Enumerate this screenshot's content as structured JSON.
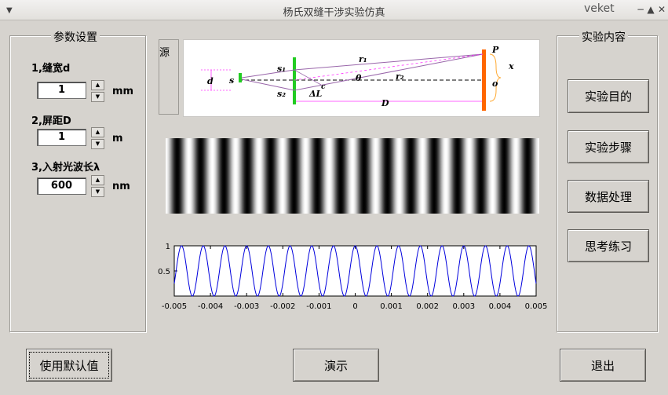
{
  "window": {
    "title": "杨氏双缝干涉实验仿真",
    "app_name": "veket",
    "menu_glyph": "▼",
    "minimize_glyph": "−",
    "maximize_glyph": "▲",
    "close_glyph": "✕"
  },
  "params": {
    "group_title": "参数设置",
    "slit_width_label": "1,缝宽d",
    "slit_width_value": "1",
    "slit_width_unit": "mm",
    "screen_dist_label": "2,屏距D",
    "screen_dist_value": "1",
    "screen_dist_unit": "m",
    "wavelength_label": "3,入射光波长λ",
    "wavelength_value": "600",
    "wavelength_unit": "nm",
    "spin_up": "▲",
    "spin_down": "▼"
  },
  "diagram": {
    "side_label": "源",
    "labels": {
      "s": "s",
      "s1": "s₁",
      "s2": "s₂",
      "d": "d",
      "theta": "θ",
      "r1": "r₁",
      "r2": "r₂",
      "dL": "ΔL",
      "c": "c",
      "D": "D",
      "P": "P",
      "o": "o",
      "x": "x"
    },
    "colors": {
      "slit": "#22cc22",
      "screen": "#ff6600",
      "rays": "#9966aa",
      "dim": "#ff33ff"
    }
  },
  "fringes": {
    "periods": 16
  },
  "chart_data": {
    "type": "line",
    "title": "",
    "xlabel": "",
    "ylabel": "",
    "xlim": [
      -0.005,
      0.005
    ],
    "ylim": [
      0,
      1
    ],
    "x_ticks": [
      "-0.005",
      "-0.004",
      "-0.003",
      "-0.002",
      "-0.001",
      "0",
      "0.001",
      "0.002",
      "0.003",
      "0.004",
      "0.005"
    ],
    "y_ticks": [
      "1",
      "0.5"
    ],
    "series": [
      {
        "function": "cos2",
        "fringe_spacing": 0.0006,
        "amplitude": 1,
        "color": "#0000dd"
      }
    ]
  },
  "experiment": {
    "group_title": "实验内容",
    "buttons": [
      "实验目的",
      "实验步骤",
      "数据处理",
      "思考练习"
    ]
  },
  "bottom": {
    "default_button": "使用默认值",
    "demo_button": "演示",
    "exit_button": "退出"
  }
}
